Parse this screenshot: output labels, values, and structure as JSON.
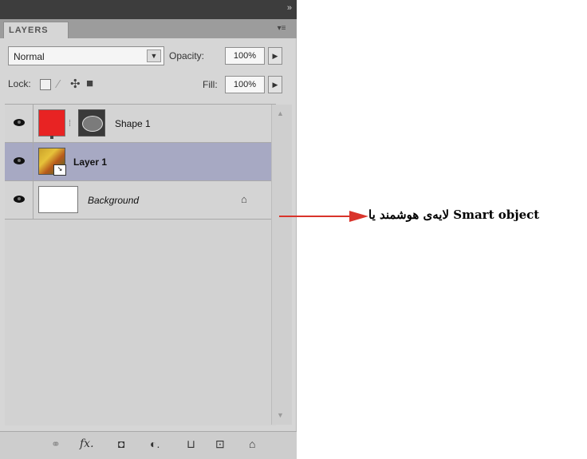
{
  "panel": {
    "tab_label": "LAYERS",
    "menu_glyph": "▾≡",
    "collapse_glyph": "»"
  },
  "controls": {
    "blend_mode": "Normal",
    "opacity_label": "Opacity:",
    "opacity_value": "100%",
    "lock_label": "Lock:",
    "fill_label": "Fill:",
    "fill_value": "100%"
  },
  "layers": [
    {
      "name": "Shape 1",
      "visible": true,
      "selected": false,
      "thumb": "red-fill",
      "has_mask": true
    },
    {
      "name": "Layer 1",
      "visible": true,
      "selected": true,
      "thumb": "smart-object",
      "has_mask": false
    },
    {
      "name": "Background",
      "visible": true,
      "selected": false,
      "thumb": "white",
      "locked": true
    }
  ],
  "bottom_tools": [
    "link-icon",
    "fx-icon",
    "mask-icon",
    "adjustment-icon",
    "group-icon",
    "new-layer-icon",
    "trash-icon"
  ],
  "bottom_tool_glyphs": {
    "link": "⚭",
    "fx": "fx.",
    "mask": "◘",
    "adjust": "◐.",
    "group": "⊔",
    "newlayer": "⊡",
    "trash": "⌂"
  },
  "annotation": {
    "text": "لایه‌ی هوشمند یا Smart object"
  },
  "colors": {
    "selected_row": "#a7a9c3",
    "arrow": "#d9342b",
    "shape_fill": "#e82323"
  }
}
